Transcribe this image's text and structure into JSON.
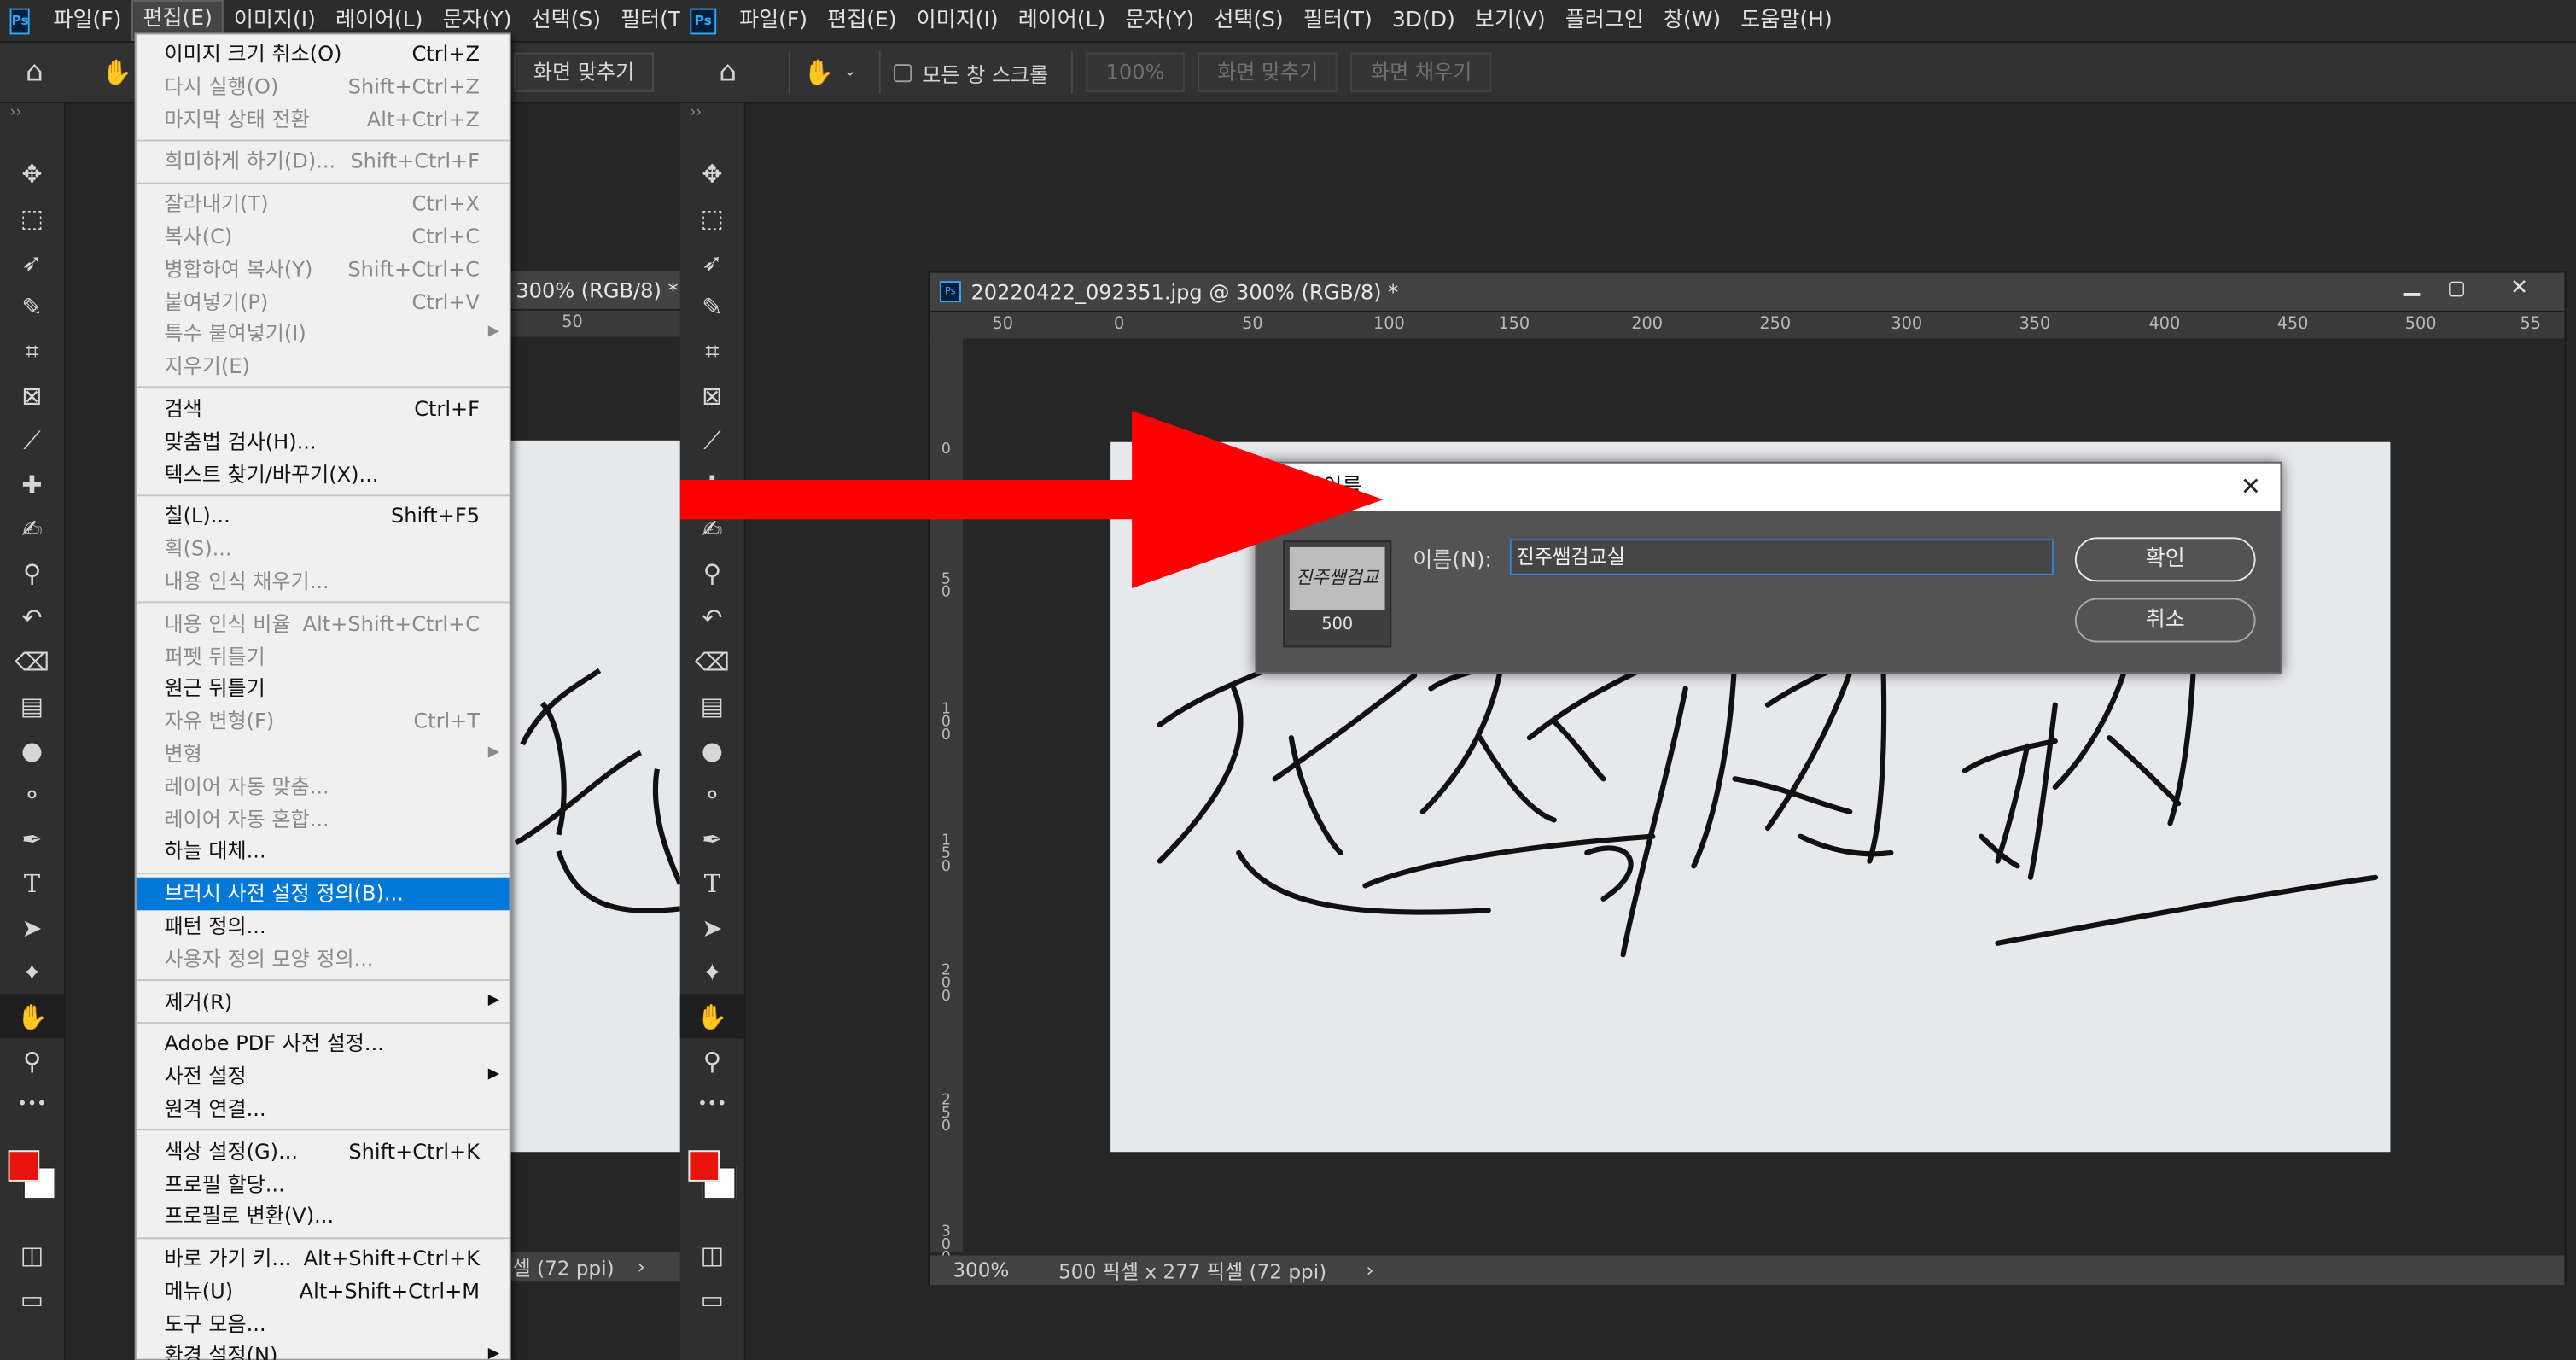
{
  "app": {
    "logo": "Ps"
  },
  "left_window": {
    "menu": [
      {
        "label": "파일(F)"
      },
      {
        "label": "편집(E)"
      },
      {
        "label": "이미지(I)"
      },
      {
        "label": "레이어(L)"
      },
      {
        "label": "문자(Y)"
      },
      {
        "label": "선택(S)"
      },
      {
        "label": "필터(T)"
      }
    ],
    "options": {
      "fit_screen": "화면 맞추기"
    },
    "tab_title_fragment": "300% (RGB/8) *",
    "ruler_tick": "50",
    "status": "셀 (72 ppi)",
    "status_arrow": "›"
  },
  "right_window": {
    "menu": [
      {
        "label": "파일(F)"
      },
      {
        "label": "편집(E)"
      },
      {
        "label": "이미지(I)"
      },
      {
        "label": "레이어(L)"
      },
      {
        "label": "문자(Y)"
      },
      {
        "label": "선택(S)"
      },
      {
        "label": "필터(T)"
      },
      {
        "label": "3D(D)"
      },
      {
        "label": "보기(V)"
      },
      {
        "label": "플러그인"
      },
      {
        "label": "창(W)"
      },
      {
        "label": "도움말(H)"
      }
    ],
    "options": {
      "scroll_all": "모든 창 스크롤",
      "zoom_value": "100%",
      "fit_screen": "화면 맞추기",
      "fill_screen": "화면 채우기"
    },
    "doc_title": "20220422_092351.jpg @ 300% (RGB/8) *",
    "ruler_h": [
      "50",
      "0",
      "50",
      "100",
      "150",
      "200",
      "250",
      "300",
      "350",
      "400",
      "450",
      "500",
      "55"
    ],
    "ruler_v": [
      "0",
      "50",
      "100",
      "150",
      "200",
      "250",
      "300"
    ],
    "status_zoom": "300%",
    "status_info": "500 픽셀 x 277 픽셀 (72 ppi)",
    "status_arrow": "›"
  },
  "edit_menu": {
    "groups": [
      [
        {
          "label": "이미지 크기 취소(O)",
          "shortcut": "Ctrl+Z",
          "disabled": false
        },
        {
          "label": "다시 실행(O)",
          "shortcut": "Shift+Ctrl+Z",
          "disabled": true
        },
        {
          "label": "마지막 상태 전환",
          "shortcut": "Alt+Ctrl+Z",
          "disabled": true
        }
      ],
      [
        {
          "label": "희미하게 하기(D)...",
          "shortcut": "Shift+Ctrl+F",
          "disabled": true
        }
      ],
      [
        {
          "label": "잘라내기(T)",
          "shortcut": "Ctrl+X",
          "disabled": true
        },
        {
          "label": "복사(C)",
          "shortcut": "Ctrl+C",
          "disabled": true
        },
        {
          "label": "병합하여 복사(Y)",
          "shortcut": "Shift+Ctrl+C",
          "disabled": true
        },
        {
          "label": "붙여넣기(P)",
          "shortcut": "Ctrl+V",
          "disabled": true
        },
        {
          "label": "특수 붙여넣기(I)",
          "shortcut": "",
          "disabled": true,
          "submenu": true
        },
        {
          "label": "지우기(E)",
          "shortcut": "",
          "disabled": true
        }
      ],
      [
        {
          "label": "검색",
          "shortcut": "Ctrl+F",
          "disabled": false
        },
        {
          "label": "맞춤법 검사(H)...",
          "shortcut": "",
          "disabled": false
        },
        {
          "label": "텍스트 찾기/바꾸기(X)...",
          "shortcut": "",
          "disabled": false
        }
      ],
      [
        {
          "label": "칠(L)...",
          "shortcut": "Shift+F5",
          "disabled": false
        },
        {
          "label": "획(S)...",
          "shortcut": "",
          "disabled": true
        },
        {
          "label": "내용 인식 채우기...",
          "shortcut": "",
          "disabled": true
        }
      ],
      [
        {
          "label": "내용 인식 비율",
          "shortcut": "Alt+Shift+Ctrl+C",
          "disabled": true
        },
        {
          "label": "퍼펫 뒤틀기",
          "shortcut": "",
          "disabled": true
        },
        {
          "label": "원근 뒤틀기",
          "shortcut": "",
          "disabled": false
        },
        {
          "label": "자유 변형(F)",
          "shortcut": "Ctrl+T",
          "disabled": true
        },
        {
          "label": "변형",
          "shortcut": "",
          "disabled": true,
          "submenu": true
        },
        {
          "label": "레이어 자동 맞춤...",
          "shortcut": "",
          "disabled": true
        },
        {
          "label": "레이어 자동 혼합...",
          "shortcut": "",
          "disabled": true
        },
        {
          "label": "하늘 대체...",
          "shortcut": "",
          "disabled": false
        }
      ],
      [
        {
          "label": "브러시 사전 설정 정의(B)...",
          "shortcut": "",
          "disabled": false,
          "highlighted": true
        },
        {
          "label": "패턴 정의...",
          "shortcut": "",
          "disabled": false
        },
        {
          "label": "사용자 정의 모양 정의...",
          "shortcut": "",
          "disabled": true
        }
      ],
      [
        {
          "label": "제거(R)",
          "shortcut": "",
          "disabled": false,
          "submenu": true
        }
      ],
      [
        {
          "label": "Adobe PDF 사전 설정...",
          "shortcut": "",
          "disabled": false
        },
        {
          "label": "사전 설정",
          "shortcut": "",
          "disabled": false,
          "submenu": true
        },
        {
          "label": "원격 연결...",
          "shortcut": "",
          "disabled": false
        }
      ],
      [
        {
          "label": "색상 설정(G)...",
          "shortcut": "Shift+Ctrl+K",
          "disabled": false
        },
        {
          "label": "프로필 할당...",
          "shortcut": "",
          "disabled": false
        },
        {
          "label": "프로필로 변환(V)...",
          "shortcut": "",
          "disabled": false
        }
      ],
      [
        {
          "label": "바로 가기 키...",
          "shortcut": "Alt+Shift+Ctrl+K",
          "disabled": false
        },
        {
          "label": "메뉴(U)",
          "shortcut": "Alt+Shift+Ctrl+M",
          "disabled": false
        },
        {
          "label": "도구 모음...",
          "shortcut": "",
          "disabled": false
        },
        {
          "label": "환경 설정(N)",
          "shortcut": "",
          "disabled": false,
          "submenu": true
        }
      ]
    ]
  },
  "dialog": {
    "title_fragment": "이름",
    "close": "✕",
    "thumb_label": "500",
    "name_label": "이름(N):",
    "name_value": "진주쌤검교실",
    "ok": "확인",
    "cancel": "취소"
  },
  "handwriting": "진주쌤검교실",
  "colors": {
    "foreground": "#e8140c",
    "background": "#ffffff",
    "highlight": "#0078d7",
    "arrow": "#ff0000"
  }
}
